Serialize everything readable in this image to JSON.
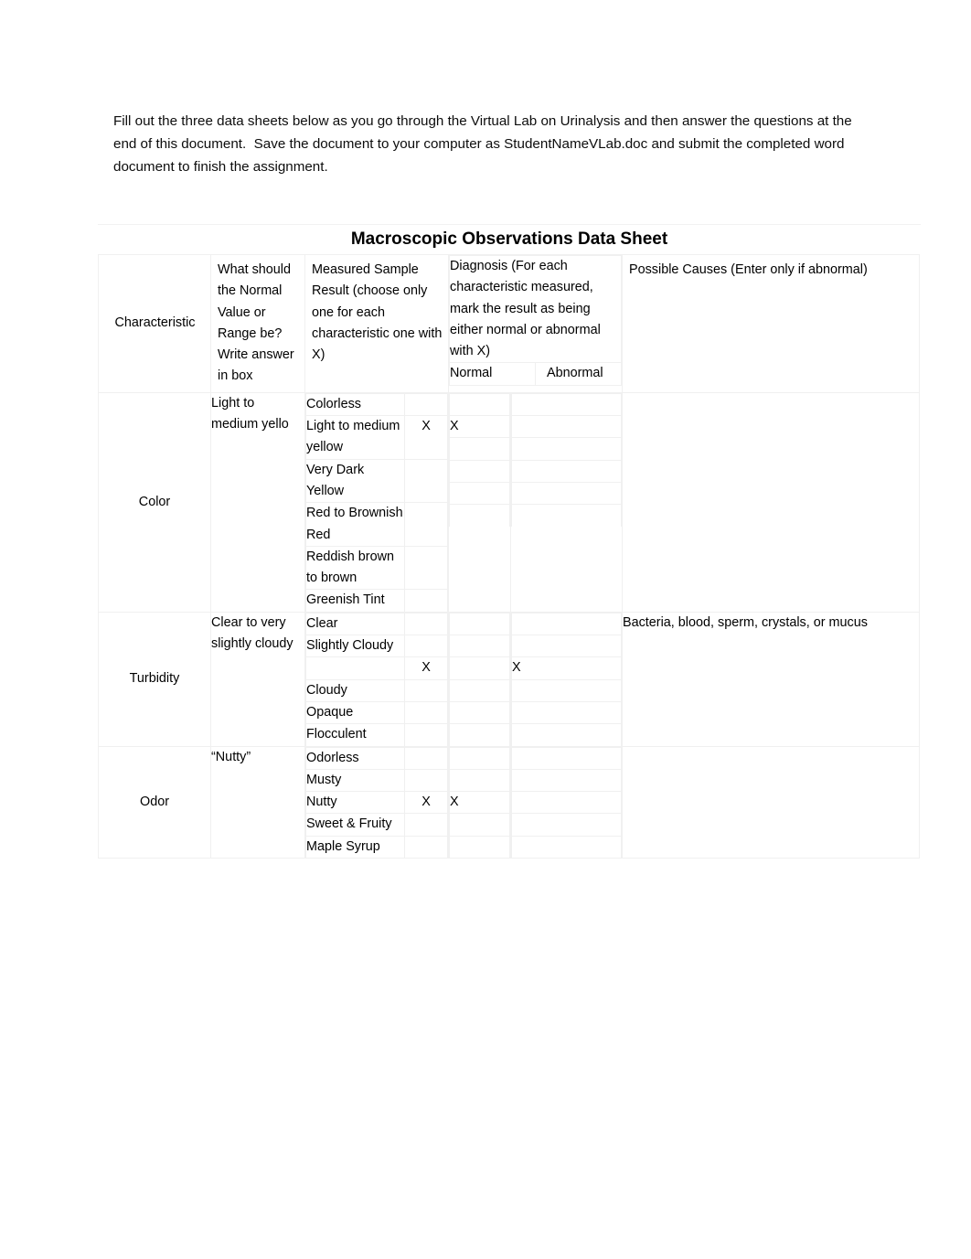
{
  "document": {
    "intro_paragraph": "Fill out the three data sheets below as you go through the Virtual Lab on Urinalysis and then answer the questions at the end of this document.  Save the document to your computer as StudentNameVLab.doc and submit the completed word document to finish the assignment."
  },
  "table": {
    "title": "Macroscopic Observations Data Sheet",
    "headers": {
      "characteristic": "Characteristic",
      "normal_value": "What should the Normal Value or Range be? Write answer in box",
      "measured_result": "Measured Sample Result (choose only one for each characteristic one with X)",
      "diagnosis": "Diagnosis (For each characteristic measured, mark the result as being either normal or abnormal with X)",
      "diagnosis_normal": "Normal",
      "diagnosis_abnormal": "Abnormal",
      "possible_causes": "Possible Causes (Enter only if abnormal)"
    },
    "rows": [
      {
        "characteristic": "Color",
        "normal_value": "Light to medium yello",
        "possible_causes": "",
        "options": [
          {
            "label": "Colorless",
            "measured_x": "",
            "normal_x": "",
            "abnormal_x": ""
          },
          {
            "label": "Light to medium yellow",
            "measured_x": "X",
            "normal_x": "X",
            "abnormal_x": ""
          },
          {
            "label": "Very Dark Yellow",
            "measured_x": "",
            "normal_x": "",
            "abnormal_x": ""
          },
          {
            "label": "Red to Brownish Red",
            "measured_x": "",
            "normal_x": "",
            "abnormal_x": ""
          },
          {
            "label": "Reddish brown to brown",
            "measured_x": "",
            "normal_x": "",
            "abnormal_x": ""
          },
          {
            "label": "Greenish Tint",
            "measured_x": "",
            "normal_x": "",
            "abnormal_x": ""
          }
        ]
      },
      {
        "characteristic": "Turbidity",
        "normal_value": "Clear to very slightly cloudy",
        "possible_causes": "Bacteria, blood, sperm, crystals, or mucus",
        "options": [
          {
            "label": "Clear",
            "measured_x": "",
            "normal_x": "",
            "abnormal_x": ""
          },
          {
            "label": "Slightly Cloudy",
            "measured_x": "",
            "normal_x": "",
            "abnormal_x": ""
          },
          {
            "label": "",
            "measured_x": "X",
            "normal_x": "",
            "abnormal_x": "X"
          },
          {
            "label": "Cloudy",
            "measured_x": "",
            "normal_x": "",
            "abnormal_x": ""
          },
          {
            "label": "Opaque",
            "measured_x": "",
            "normal_x": "",
            "abnormal_x": ""
          },
          {
            "label": "Flocculent",
            "measured_x": "",
            "normal_x": "",
            "abnormal_x": ""
          }
        ]
      },
      {
        "characteristic": "Odor",
        "normal_value": "“Nutty”",
        "possible_causes": "",
        "options": [
          {
            "label": "Odorless",
            "measured_x": "",
            "normal_x": "",
            "abnormal_x": ""
          },
          {
            "label": "Musty",
            "measured_x": "",
            "normal_x": "",
            "abnormal_x": ""
          },
          {
            "label": "Nutty",
            "measured_x": "X",
            "normal_x": "X",
            "abnormal_x": ""
          },
          {
            "label": "Sweet & Fruity",
            "measured_x": "",
            "normal_x": "",
            "abnormal_x": ""
          },
          {
            "label": "Maple Syrup",
            "measured_x": "",
            "normal_x": "",
            "abnormal_x": ""
          }
        ]
      }
    ]
  },
  "colors": {
    "header_green": "#e3ecd9",
    "subheader_cream": "#faeccd",
    "gridline": "#f0f0f0",
    "page_background": "#ffffff",
    "text": "#000000"
  }
}
